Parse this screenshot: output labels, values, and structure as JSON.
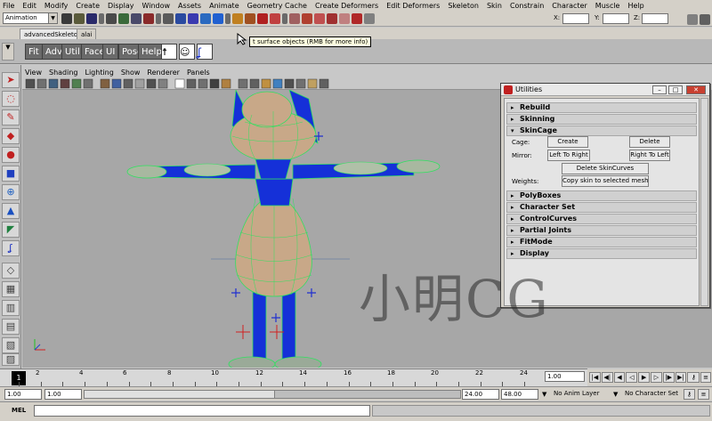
{
  "menu": [
    "File",
    "Edit",
    "Modify",
    "Create",
    "Display",
    "Window",
    "Assets",
    "Animate",
    "Geometry Cache",
    "Create Deformers",
    "Edit Deformers",
    "Skeleton",
    "Skin",
    "Constrain",
    "Character",
    "Muscle",
    "Help"
  ],
  "status": {
    "mode": "Animation",
    "x_label": "X:",
    "y_label": "Y:",
    "z_label": "Z:"
  },
  "shelf": {
    "tabs": [
      "advancedSkeleton",
      "alai"
    ],
    "buttons": [
      "Fit",
      "Adv",
      "Util",
      "Face",
      "UI",
      "Pose",
      "Help"
    ],
    "tooltip": "t surface objects (RMB for more info)"
  },
  "panel_menu": [
    "View",
    "Shading",
    "Lighting",
    "Show",
    "Renderer",
    "Panels"
  ],
  "utilities": {
    "title": "Utilities",
    "frames": [
      "Rebuild",
      "Skinning",
      "SkinCage",
      "PolyBoxes",
      "Character Set",
      "ControlCurves",
      "Partial Joints",
      "FitMode",
      "Display"
    ],
    "cage_label": "Cage:",
    "create_btn": "Create",
    "delete_btn": "Delete",
    "mirror_label": "Mirror:",
    "left_to_right_btn": "Left To Right",
    "right_to_left_btn": "Right To Left",
    "delete_skincurves_btn": "Delete SkinCurves",
    "weights_label": "Weights:",
    "copy_skin_btn": "Copy skin to selected mesh"
  },
  "watermark": "小明CG",
  "timeline": {
    "current_frame": "1",
    "ticks": [
      "2",
      "4",
      "6",
      "8",
      "10",
      "12",
      "14",
      "16",
      "18",
      "20",
      "22",
      "24"
    ],
    "frame_field": "1.00"
  },
  "range": {
    "start": "1.00",
    "start_inner": "1.00",
    "end_inner": "24.00",
    "end": "48.00",
    "anim_layer": "No Anim Layer",
    "char_set": "No Character Set"
  },
  "command": {
    "label": "MEL"
  },
  "colors": {
    "viewport_bg": "#a7a7a7",
    "rig_blue": "#1530d8",
    "wire_green": "#30e060",
    "mesh_skin": "#c8a888"
  }
}
